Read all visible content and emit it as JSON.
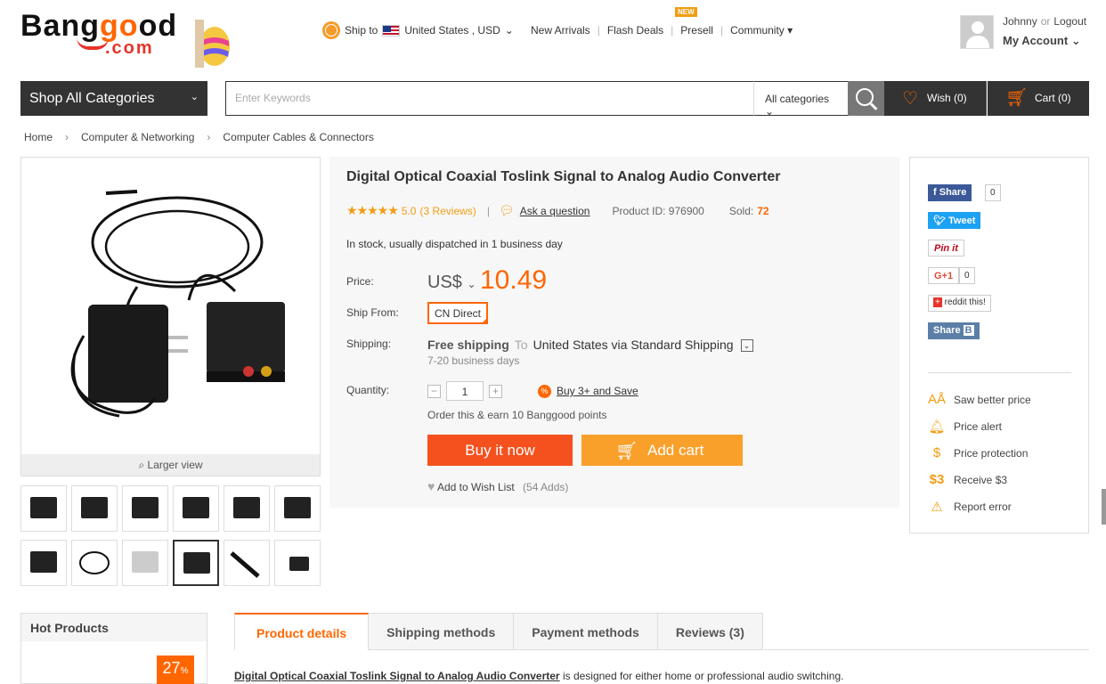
{
  "logo": {
    "text_before": "Bang",
    "text_o1": "g",
    "text_o2": "o",
    "text_after": "od",
    "com": ".com"
  },
  "header": {
    "ship_label": "Ship to",
    "ship_region": "United States , USD",
    "nav": [
      "New Arrivals",
      "Flash Deals",
      "Presell",
      "Community"
    ],
    "new_badge": "NEW",
    "user_name": "Johnny",
    "or": "or",
    "logout": "Logout",
    "my_account": "My Account"
  },
  "searchbar": {
    "shop_all": "Shop All Categories",
    "placeholder": "Enter Keywords",
    "category": "All categories",
    "wish": "Wish (0)",
    "cart": "Cart (0)"
  },
  "breadcrumb": [
    "Home",
    "Computer & Networking",
    "Computer Cables & Connectors"
  ],
  "gallery": {
    "larger_view": "Larger view",
    "thumb_count": 12,
    "selected_index": 9
  },
  "product": {
    "title": "Digital Optical Coaxial Toslink Signal to Analog Audio Converter",
    "rating": "5.0",
    "reviews": "(3 Reviews)",
    "ask": "Ask a question",
    "product_id": "Product ID: 976900",
    "sold_label": "Sold:",
    "sold_value": "72",
    "stock": "In stock, usually dispatched in 1 business day",
    "price_label": "Price:",
    "currency": "US$",
    "price": "10.49",
    "ship_from_label": "Ship From:",
    "ship_from": "CN Direct",
    "shipping_label": "Shipping:",
    "free_shipping": "Free shipping",
    "to": "To",
    "ship_dest": "United States via Standard Shipping",
    "ship_days": "7-20 business days",
    "quantity_label": "Quantity:",
    "quantity": "1",
    "buy3": "Buy 3+ and Save",
    "earn": "Order this & earn 10 Banggood points",
    "buy_now": "Buy it now",
    "add_cart": "Add cart",
    "wishlist": "Add to Wish List",
    "wish_adds": "(54 Adds)"
  },
  "social": {
    "fb": "Share",
    "fb_count": "0",
    "tweet": "Tweet",
    "pinit": "Pin it",
    "gplus": "G+1",
    "gplus_count": "0",
    "reddit": "reddit this!",
    "vk": "Share"
  },
  "side_links": [
    "Saw better price",
    "Price alert",
    "Price protection",
    "Receive $3",
    "Report error"
  ],
  "hot_products": {
    "title": "Hot Products",
    "discount": "27"
  },
  "tabs": [
    "Product details",
    "Shipping methods",
    "Payment methods",
    "Reviews (3)"
  ],
  "description": {
    "bold": "Digital Optical Coaxial Toslink Signal to Analog Audio Converter",
    "rest": " is designed for either home or professional audio switching."
  }
}
